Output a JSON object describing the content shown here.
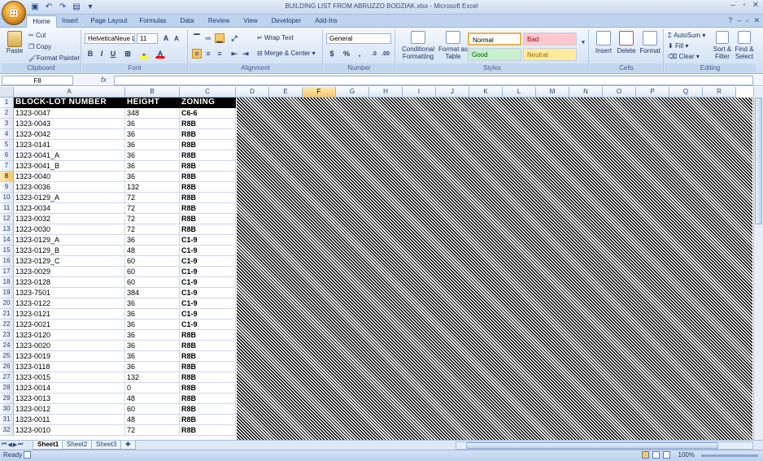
{
  "window": {
    "title": "BUILDING LIST FROM ABRUZZO BODZIAK.xlsx - Microsoft Excel",
    "office_button": "⊞"
  },
  "tabs": [
    "Home",
    "Insert",
    "Page Layout",
    "Formulas",
    "Data",
    "Review",
    "View",
    "Developer",
    "Add-Ins"
  ],
  "ribbon": {
    "clipboard": {
      "paste": "Paste",
      "cut": "Cut",
      "copy": "Copy",
      "format_painter": "Format Painter",
      "label": "Clipboard"
    },
    "font": {
      "name": "HelveticaNeue L",
      "size": "11",
      "bold": "B",
      "italic": "I",
      "underline": "U",
      "label": "Font"
    },
    "alignment": {
      "wrap": "Wrap Text",
      "merge": "Merge & Center",
      "label": "Alignment"
    },
    "number": {
      "format": "General",
      "currency": "$",
      "percent": "%",
      "comma": ",",
      "label": "Number"
    },
    "styles": {
      "conditional": "Conditional Formatting",
      "format_table": "Format as Table",
      "normal": "Normal",
      "bad": "Bad",
      "good": "Good",
      "neutral": "Neutral",
      "label": "Styles"
    },
    "cells": {
      "insert": "Insert",
      "delete": "Delete",
      "format": "Format",
      "label": "Cells"
    },
    "editing": {
      "autosum": "AutoSum",
      "fill": "Fill",
      "clear": "Clear",
      "sort": "Sort & Filter",
      "find": "Find & Select",
      "label": "Editing"
    }
  },
  "formula_bar": {
    "name_box": "F8",
    "fx": "fx",
    "value": ""
  },
  "columns": [
    "A",
    "B",
    "C",
    "D",
    "E",
    "F",
    "G",
    "H",
    "I",
    "J",
    "K",
    "L",
    "M",
    "N",
    "O",
    "P",
    "Q",
    "R"
  ],
  "selected_column": "F",
  "selected_row": 8,
  "headers": {
    "col_a": "BLOCK-LOT NUMBER",
    "col_b": "HEIGHT",
    "col_c": "ZONING"
  },
  "rows": [
    {
      "num": "2",
      "a": "1323-0047",
      "b": "348",
      "c": "C6-6"
    },
    {
      "num": "3",
      "a": "1323-0043",
      "b": "36",
      "c": "R8B"
    },
    {
      "num": "4",
      "a": "1323-0042",
      "b": "36",
      "c": "R8B"
    },
    {
      "num": "5",
      "a": "1323-0141",
      "b": "36",
      "c": "R8B"
    },
    {
      "num": "6",
      "a": "1323-0041_A",
      "b": "36",
      "c": "R8B"
    },
    {
      "num": "7",
      "a": "1323-0041_B",
      "b": "36",
      "c": "R8B"
    },
    {
      "num": "8",
      "a": "1323-0040",
      "b": "36",
      "c": "R8B"
    },
    {
      "num": "9",
      "a": "1323-0036",
      "b": "132",
      "c": "R8B"
    },
    {
      "num": "10",
      "a": "1323-0129_A",
      "b": "72",
      "c": "R8B"
    },
    {
      "num": "11",
      "a": "1323-0034",
      "b": "72",
      "c": "R8B"
    },
    {
      "num": "12",
      "a": "1323-0032",
      "b": "72",
      "c": "R8B"
    },
    {
      "num": "13",
      "a": "1323-0030",
      "b": "72",
      "c": "R8B"
    },
    {
      "num": "14",
      "a": "1323-0129_A",
      "b": "36",
      "c": "C1-9"
    },
    {
      "num": "15",
      "a": "1323-0129_B",
      "b": "48",
      "c": "C1-9"
    },
    {
      "num": "16",
      "a": "1323-0129_C",
      "b": "60",
      "c": "C1-9"
    },
    {
      "num": "17",
      "a": "1323-0029",
      "b": "60",
      "c": "C1-9"
    },
    {
      "num": "18",
      "a": "1323-0128",
      "b": "60",
      "c": "C1-9"
    },
    {
      "num": "19",
      "a": "1323-7501",
      "b": "384",
      "c": "C1-9"
    },
    {
      "num": "20",
      "a": "1323-0122",
      "b": "36",
      "c": "C1-9"
    },
    {
      "num": "21",
      "a": "1323-0121",
      "b": "36",
      "c": "C1-9"
    },
    {
      "num": "22",
      "a": "1323-0021",
      "b": "36",
      "c": "C1-9"
    },
    {
      "num": "23",
      "a": "1323-0120",
      "b": "36",
      "c": "R8B"
    },
    {
      "num": "24",
      "a": "1323-0020",
      "b": "36",
      "c": "R8B"
    },
    {
      "num": "25",
      "a": "1323-0019",
      "b": "36",
      "c": "R8B"
    },
    {
      "num": "26",
      "a": "1323-0118",
      "b": "36",
      "c": "R8B"
    },
    {
      "num": "27",
      "a": "1323-0015",
      "b": "132",
      "c": "R8B"
    },
    {
      "num": "28",
      "a": "1323-0014",
      "b": "0",
      "c": "R8B"
    },
    {
      "num": "29",
      "a": "1323-0013",
      "b": "48",
      "c": "R8B"
    },
    {
      "num": "30",
      "a": "1323-0012",
      "b": "60",
      "c": "R8B"
    },
    {
      "num": "31",
      "a": "1323-0011",
      "b": "48",
      "c": "R8B"
    },
    {
      "num": "32",
      "a": "1323-0010",
      "b": "72",
      "c": "R8B"
    }
  ],
  "sheets": [
    "Sheet1",
    "Sheet2",
    "Sheet3"
  ],
  "status": {
    "ready": "Ready",
    "zoom": "100%"
  },
  "colors": {
    "accent": "#f8c766",
    "ribbon": "#dbe7f6",
    "header_fill": "#000000"
  }
}
